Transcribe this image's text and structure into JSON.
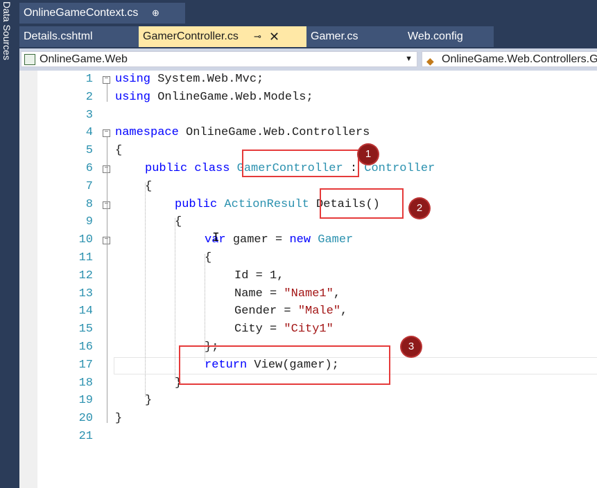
{
  "side_panel": {
    "label": "Data Sources"
  },
  "tabs_row1": [
    {
      "label": "OnlineGameContext.cs",
      "pin": "⊕"
    }
  ],
  "tabs_row2": [
    {
      "label": "Details.cshtml"
    },
    {
      "label": "GamerController.cs",
      "pin": "⊸",
      "close": "✕",
      "active": true
    },
    {
      "label": "Gamer.cs"
    },
    {
      "label": "Web.config"
    }
  ],
  "navbar": {
    "project": "OnlineGame.Web",
    "namespace": "OnlineGame.Web.Controllers.G"
  },
  "code_lines": [
    {
      "n": "1",
      "parts": [
        [
          "kw",
          "using"
        ],
        [
          "",
          "System.Web.Mvc;"
        ]
      ]
    },
    {
      "n": "2",
      "parts": [
        [
          "kw",
          "using"
        ],
        [
          "",
          "OnlineGame.Web.Models;"
        ]
      ]
    },
    {
      "n": "3",
      "parts": []
    },
    {
      "n": "4",
      "parts": [
        [
          "kw",
          "namespace"
        ],
        [
          "",
          "OnlineGame.Web.Controllers"
        ]
      ]
    },
    {
      "n": "5",
      "parts": [
        [
          "",
          "{"
        ]
      ]
    },
    {
      "n": "6",
      "parts": [
        [
          "kw",
          "public class"
        ],
        [
          "ty",
          "GamerController"
        ],
        [
          "",
          " : "
        ],
        [
          "ty",
          "Controller"
        ]
      ]
    },
    {
      "n": "7",
      "parts": [
        [
          "",
          "{"
        ]
      ]
    },
    {
      "n": "8",
      "parts": [
        [
          "kw",
          "public"
        ],
        [
          "ty",
          "ActionResult"
        ],
        [
          "",
          "Details()"
        ]
      ]
    },
    {
      "n": "9",
      "parts": [
        [
          "",
          "{"
        ]
      ]
    },
    {
      "n": "10",
      "parts": [
        [
          "kw",
          "var"
        ],
        [
          "",
          "gamer = "
        ],
        [
          "kw",
          "new"
        ],
        [
          "ty",
          "Gamer"
        ]
      ]
    },
    {
      "n": "11",
      "parts": [
        [
          "",
          "{"
        ]
      ]
    },
    {
      "n": "12",
      "parts": [
        [
          "",
          "Id = 1,"
        ]
      ]
    },
    {
      "n": "13",
      "parts": [
        [
          "",
          "Name = "
        ],
        [
          "st",
          "\"Name1\""
        ],
        [
          "",
          ","
        ]
      ]
    },
    {
      "n": "14",
      "parts": [
        [
          "",
          "Gender = "
        ],
        [
          "st",
          "\"Male\""
        ],
        [
          "",
          ","
        ]
      ]
    },
    {
      "n": "15",
      "parts": [
        [
          "",
          "City = "
        ],
        [
          "st",
          "\"City1\""
        ]
      ]
    },
    {
      "n": "16",
      "parts": [
        [
          "",
          "};"
        ]
      ]
    },
    {
      "n": "17",
      "parts": [
        [
          "kw",
          "return"
        ],
        [
          "",
          "View(gamer);"
        ]
      ]
    },
    {
      "n": "18",
      "parts": [
        [
          "",
          "}"
        ]
      ]
    },
    {
      "n": "19",
      "parts": [
        [
          "",
          "}"
        ]
      ]
    },
    {
      "n": "20",
      "parts": [
        [
          "",
          "}"
        ]
      ]
    },
    {
      "n": "21",
      "parts": []
    }
  ],
  "annotations": [
    {
      "label": "1"
    },
    {
      "label": "2"
    },
    {
      "label": "3"
    }
  ],
  "colors": {
    "keyword": "#0000ff",
    "type": "#2b91af",
    "string": "#a31515",
    "highlight": "#e53a3a",
    "badge": "#8e1a1a"
  }
}
